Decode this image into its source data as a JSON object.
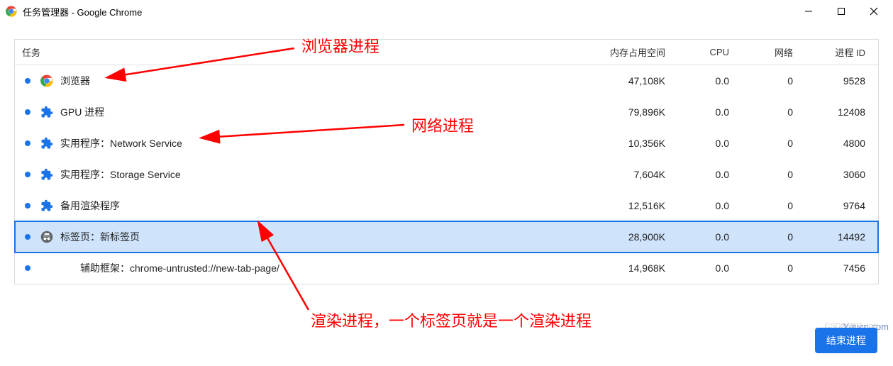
{
  "window": {
    "title": "任务管理器 - Google Chrome"
  },
  "columns": {
    "task": "任务",
    "memory": "内存占用空间",
    "cpu": "CPU",
    "network": "网络",
    "pid": "进程 ID"
  },
  "rows": [
    {
      "icon": "chrome",
      "name": "浏览器",
      "memory": "47,108K",
      "cpu": "0.0",
      "network": "0",
      "pid": "9528"
    },
    {
      "icon": "ext",
      "name": "GPU 进程",
      "memory": "79,896K",
      "cpu": "0.0",
      "network": "0",
      "pid": "12408"
    },
    {
      "icon": "ext",
      "name": "实用程序：Network Service",
      "memory": "10,356K",
      "cpu": "0.0",
      "network": "0",
      "pid": "4800"
    },
    {
      "icon": "ext",
      "name": "实用程序：Storage Service",
      "memory": "7,604K",
      "cpu": "0.0",
      "network": "0",
      "pid": "3060"
    },
    {
      "icon": "ext",
      "name": "备用渲染程序",
      "memory": "12,516K",
      "cpu": "0.0",
      "network": "0",
      "pid": "9764"
    },
    {
      "icon": "incog",
      "name": "标签页：新标签页",
      "memory": "28,900K",
      "cpu": "0.0",
      "network": "0",
      "pid": "14492",
      "selected": true
    },
    {
      "icon": "none",
      "name": "辅助框架：chrome-untrusted://new-tab-page/",
      "memory": "14,968K",
      "cpu": "0.0",
      "network": "0",
      "pid": "7456",
      "indent": true
    }
  ],
  "button": {
    "end": "结束进程"
  },
  "watermark": "Yuucn.com",
  "credit": "CSDN @G_ing",
  "annotations": {
    "a1": "浏览器进程",
    "a2": "网络进程",
    "a3": "渲染进程，一个标签页就是一个渲染进程"
  }
}
